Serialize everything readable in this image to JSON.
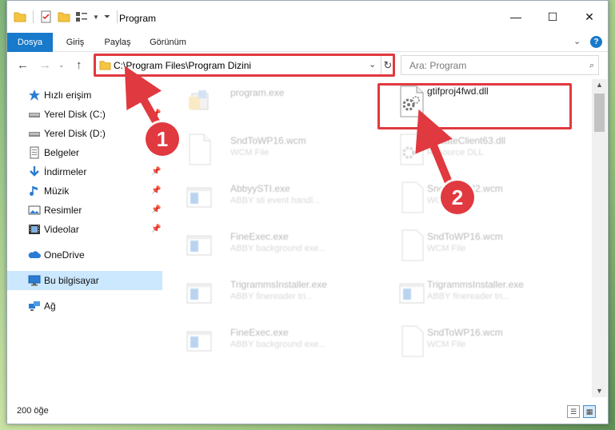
{
  "window": {
    "title": "Program",
    "controls": {
      "minimize": "—",
      "maximize": "☐",
      "close": "✕"
    }
  },
  "ribbon": {
    "tabs": [
      "Dosya",
      "Giriş",
      "Paylaş",
      "Görünüm"
    ],
    "help": "?"
  },
  "nav": {
    "address": "C:\\Program Files\\Program Dizini",
    "search_placeholder": "Ara: Program"
  },
  "sidebar": {
    "items": [
      {
        "label": "Hızlı erişim",
        "icon": "star-icon",
        "pinned": false
      },
      {
        "label": "Yerel Disk (C:)",
        "icon": "drive-icon",
        "pinned": true
      },
      {
        "label": "Yerel Disk (D:)",
        "icon": "drive-icon",
        "pinned": true
      },
      {
        "label": "Belgeler",
        "icon": "documents-icon",
        "pinned": true
      },
      {
        "label": "İndirmeler",
        "icon": "download-icon",
        "pinned": true
      },
      {
        "label": "Müzik",
        "icon": "music-icon",
        "pinned": true
      },
      {
        "label": "Resimler",
        "icon": "pictures-icon",
        "pinned": true
      },
      {
        "label": "Videolar",
        "icon": "videos-icon",
        "pinned": true
      },
      {
        "label": "OneDrive",
        "icon": "cloud-icon",
        "pinned": false
      },
      {
        "label": "Bu bilgisayar",
        "icon": "computer-icon",
        "pinned": false,
        "selected": true
      },
      {
        "label": "Ağ",
        "icon": "network-icon",
        "pinned": false
      }
    ]
  },
  "files": [
    {
      "name": "program.exe",
      "desc": "",
      "icon": "installer-icon",
      "faded": true
    },
    {
      "name": "gtifproj4fwd.dll",
      "desc": "",
      "icon": "dll-gear-icon",
      "faded": false,
      "highlighted": true
    },
    {
      "name": "SndToWP16.wcm",
      "desc": "WCM File",
      "icon": "blank-file-icon",
      "faded": true
    },
    {
      "name": "UpdateClient63.dll",
      "desc": "Resource DLL",
      "icon": "dll-gear-icon",
      "faded": true
    },
    {
      "name": "AbbyySTI.exe",
      "desc": "ABBY sti event handl...",
      "icon": "app-window-icon",
      "faded": true
    },
    {
      "name": "SndToWP32.wcm",
      "desc": "WCM File",
      "icon": "blank-file-icon",
      "faded": true
    },
    {
      "name": "FineExec.exe",
      "desc": "ABBY background exe...",
      "icon": "app-window-icon",
      "faded": true
    },
    {
      "name": "SndToWP16.wcm",
      "desc": "WCM File",
      "icon": "blank-file-icon",
      "faded": true
    },
    {
      "name": "TrigrammsInstaller.exe",
      "desc": "ABBY finereader tri...",
      "icon": "app-window-icon",
      "faded": true
    },
    {
      "name": "TrigrammsInstaller.exe",
      "desc": "ABBY finereader tri...",
      "icon": "app-window-icon",
      "faded": true
    },
    {
      "name": "FineExec.exe",
      "desc": "ABBY background exe...",
      "icon": "app-window-icon",
      "faded": true
    },
    {
      "name": "SndToWP16.wcm",
      "desc": "WCM File",
      "icon": "blank-file-icon",
      "faded": true
    }
  ],
  "status": {
    "count": "200 öğe"
  },
  "callouts": {
    "one": "1",
    "two": "2"
  },
  "colors": {
    "accent": "#1979ca",
    "highlight": "#e0393f",
    "selected": "#cce8ff"
  }
}
